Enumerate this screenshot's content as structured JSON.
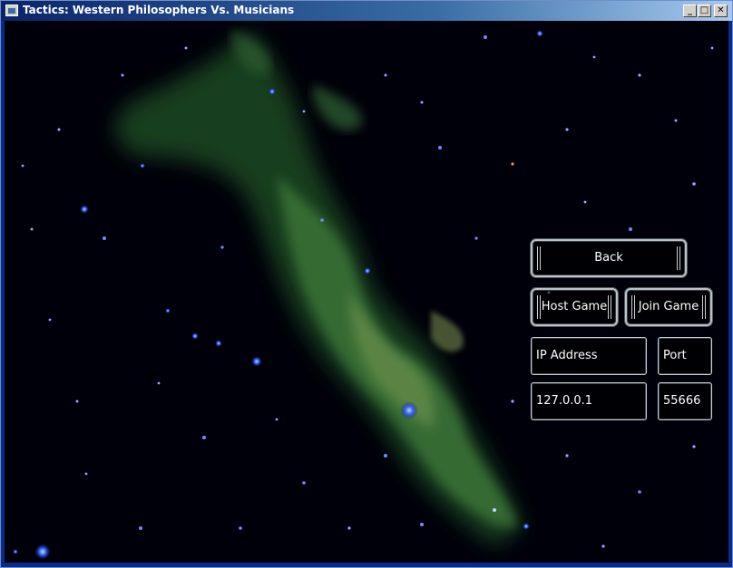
{
  "window": {
    "title": "Tactics: Western Philosophers Vs. Musicians",
    "minimize_glyph": "_",
    "maximize_glyph": "□",
    "close_glyph": "✕"
  },
  "menu": {
    "back_label": "Back",
    "host_label": "Host Game",
    "join_label": "Join Game",
    "ip_label": "IP Address",
    "port_label": "Port",
    "ip_value": "127.0.0.1",
    "port_value": "55666"
  },
  "colors": {
    "nebula_green": "#3f7a3a",
    "star_blue": "#2a55ff",
    "button_border": "#b9c2c8"
  }
}
